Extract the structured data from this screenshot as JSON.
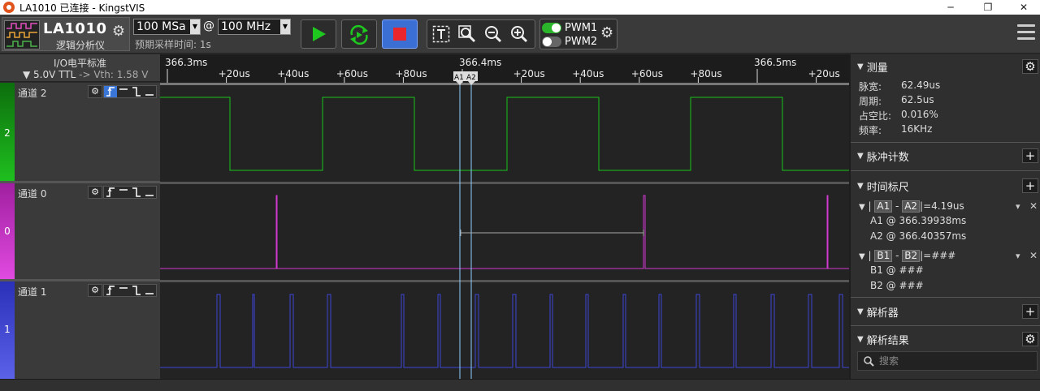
{
  "window": {
    "title": "LA1010 已连接 - KingstVIS",
    "minimize": "─",
    "maximize": "❐",
    "close": "✕"
  },
  "device": {
    "model": "LA1010",
    "subtitle": "逻辑分析仪"
  },
  "sampling": {
    "depth": "100 MSa",
    "at": "@",
    "rate": "100 MHz",
    "hint": "预期采样时间: 1s"
  },
  "pwm": [
    {
      "label": "PWM1",
      "on": true
    },
    {
      "label": "PWM2",
      "on": false
    }
  ],
  "io": {
    "title": "I/O电平标准",
    "voltage": "▼ 5.0V TTL",
    "vth": "-> Vth: 1.58 V"
  },
  "channels": [
    {
      "name": "通道 2",
      "number": "2",
      "color": "#18c318",
      "trigger_active": true
    },
    {
      "name": "通道 0",
      "number": "0",
      "color": "#d03ad0",
      "trigger_active": false
    },
    {
      "name": "通道 1",
      "number": "1",
      "color": "#3d44d6",
      "trigger_active": false
    }
  ],
  "timeline": {
    "major_labels": [
      "366.3ms",
      "366.4ms",
      "366.5ms"
    ],
    "minor_labels": [
      "+20us",
      "+40us",
      "+60us",
      "+80us",
      "+20us",
      "+40us",
      "+60us",
      "+80us",
      "+20us"
    ],
    "cursor_a1": "A1",
    "cursor_a2": "A2"
  },
  "panel": {
    "measure": {
      "title": "测量",
      "rows": [
        {
          "label": "脉宽:",
          "value": "62.49us"
        },
        {
          "label": "周期:",
          "value": "62.5us"
        },
        {
          "label": "占空比:",
          "value": "0.016%"
        },
        {
          "label": "频率:",
          "value": "16KHz"
        }
      ]
    },
    "pulse_count": {
      "title": "脉冲计数"
    },
    "time_ruler": {
      "title": "时间标尺",
      "a_pair": {
        "first": "A1",
        "second": "A2",
        "value": "=4.19us"
      },
      "a1": "A1 @ 366.39938ms",
      "a2": "A2 @ 366.40357ms",
      "b_pair": {
        "first": "B1",
        "second": "B2",
        "value": "=###"
      },
      "b1": "B1 @ ###",
      "b2": "B2 @ ###"
    },
    "analyzer": {
      "title": "解析器"
    },
    "results": {
      "title": "解析结果",
      "search_placeholder": "搜索"
    }
  },
  "icons": [
    "app-icon",
    "gear-icon",
    "play-icon",
    "loop-icon",
    "stop-icon",
    "text-cursor-icon",
    "zoom-fit-icon",
    "zoom-out-icon",
    "zoom-in-icon",
    "menu-icon",
    "search-icon",
    "pin-icon",
    "close-icon"
  ]
}
